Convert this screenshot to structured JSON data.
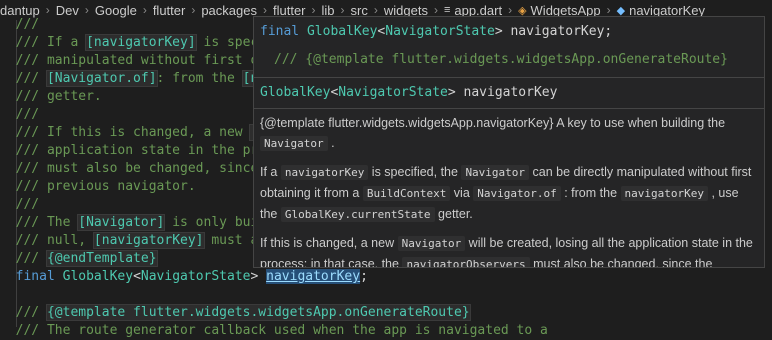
{
  "breadcrumb": {
    "items": [
      "dantup",
      "Dev",
      "Google",
      "flutter",
      "packages",
      "flutter",
      "lib",
      "src",
      "widgets"
    ],
    "file": "app.dart",
    "class_name": "WidgetsApp",
    "member_name": "navigatorKey"
  },
  "code": {
    "l1": "  ///",
    "l2a": "  /// If a ",
    "l2b": "[navigatorKey]",
    "l2c": " is specif",
    "l3": "  /// manipulated without first ob",
    "l4a": "  /// ",
    "l4b": "[Navigator.of]",
    "l4c": ": from the ",
    "l4d": "[n",
    "l5": "  /// getter.",
    "l6": "  ///",
    "l7a": "  /// If this is changed, a new ",
    "l7b": "[N",
    "l8": "  /// application state in the pro",
    "l9": "  /// must also be changed, since ",
    "l10": "  /// previous navigator.",
    "l11": "  ///",
    "l12a": "  /// The ",
    "l12b": "[Navigator]",
    "l12c": " is only buil",
    "l13a": "  /// null, ",
    "l13b": "[navigatorKey]",
    "l13c": " must al",
    "l14a": "  /// ",
    "l14b": "{@endTemplate}",
    "l15a": "  ",
    "l15b": "final",
    "l15c": " ",
    "l15d": "GlobalKey",
    "l15e": "<",
    "l15f": "NavigatorState",
    "l15g": "> ",
    "l15h": "navigatorKey",
    "l15i": ";",
    "l16": "",
    "l17a": "  /// ",
    "l17b": "{@template flutter.widgets.widgetsApp.onGenerateRoute}",
    "l18": "  /// The route generator callback used when the app is navigated to a"
  },
  "hover": {
    "sig_kw": "final",
    "sig_type": "GlobalKey",
    "sig_lt": "<",
    "sig_generic": "NavigatorState",
    "sig_gt": ">",
    "sig_name": " navigatorKey;",
    "sig_template": "/// {@template flutter.widgets.widgetsApp.onGenerateRoute}",
    "decl_type": "GlobalKey",
    "decl_lt": "<",
    "decl_generic": "NavigatorState",
    "decl_gt": ">",
    "decl_name": " navigatorKey",
    "p1_a": "{@template flutter.widgets.widgetsApp.navigatorKey} A key to use when building the ",
    "p1_code": "Navigator",
    "p1_b": " .",
    "p2_a": "If a ",
    "p2_c1": "navigatorKey",
    "p2_b": " is specified, the ",
    "p2_c2": "Navigator",
    "p2_c": " can be directly manipulated without first obtaining it from a ",
    "p2_c3": "BuildContext",
    "p2_d": " via ",
    "p2_c4": "Navigator.of",
    "p2_e": " : from the ",
    "p2_c5": "navigatorKey",
    "p2_f": " , use the ",
    "p2_c6": "GlobalKey.currentState",
    "p2_g": " getter.",
    "p3_a": "If this is changed, a new ",
    "p3_c1": "Navigator",
    "p3_b": " will be created, losing all the application state in the process; in that case, the ",
    "p3_c2": "navigatorObservers",
    "p3_c": " must also be changed, since the previous observers will be attached to the previous navigator."
  },
  "colors": {
    "background": "#1e1e1e",
    "comment": "#6a9955",
    "keyword": "#569cd6",
    "type": "#4ec9b0",
    "selection": "#264f78",
    "hover_bg": "#252526"
  }
}
